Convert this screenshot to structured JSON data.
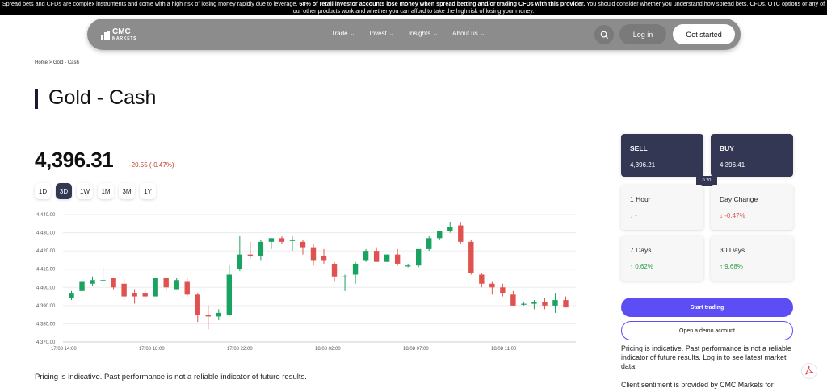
{
  "risk_warning": {
    "part1": "Spread bets and CFDs are complex instruments and come with a high risk of losing money rapidly due to leverage. ",
    "bold": "68% of retail investor accounts lose money when spread betting and/or trading CFDs with this provider.",
    "part2": " You should consider whether you understand how spread bets, CFDs, OTC options or any of our other products work and whether you can afford to take the high risk of losing your money."
  },
  "nav": {
    "logo_top": "CMC",
    "logo_bottom": "MARKETS",
    "links": [
      "Trade",
      "Invest",
      "Insights",
      "About us"
    ],
    "login": "Log in",
    "get_started": "Get started"
  },
  "breadcrumb": "Home > Gold - Cash",
  "page_title": "Gold - Cash",
  "price": "4,396.31",
  "change": "-20.55 (-0.47%)",
  "ranges": [
    "1D",
    "3D",
    "1W",
    "1M",
    "3M",
    "1Y"
  ],
  "active_range": "3D",
  "chart_data": {
    "type": "candlestick",
    "ylim": [
      4370,
      4440
    ],
    "y_ticks": [
      "4,440.00",
      "4,430.00",
      "4,420.00",
      "4,410.00",
      "4,400.00",
      "4,390.00",
      "4,380.00",
      "4,370.00"
    ],
    "x_ticks": [
      "17/08 14:00",
      "17/08 18:00",
      "17/08 22:00",
      "18/08 02:00",
      "18/08 07:00",
      "18/08 11:00"
    ],
    "candles": [
      {
        "o": 4394,
        "h": 4398,
        "l": 4393,
        "c": 4397
      },
      {
        "o": 4398,
        "h": 4403,
        "l": 4392,
        "c": 4403
      },
      {
        "o": 4402,
        "h": 4406,
        "l": 4401,
        "c": 4404
      },
      {
        "o": 4404,
        "h": 4411,
        "l": 4403,
        "c": 4404
      },
      {
        "o": 4405,
        "h": 4405,
        "l": 4399,
        "c": 4400
      },
      {
        "o": 4402,
        "h": 4405,
        "l": 4393,
        "c": 4395
      },
      {
        "o": 4397,
        "h": 4399,
        "l": 4391,
        "c": 4395
      },
      {
        "o": 4397,
        "h": 4399,
        "l": 4394,
        "c": 4395
      },
      {
        "o": 4395,
        "h": 4405,
        "l": 4395,
        "c": 4405
      },
      {
        "o": 4405,
        "h": 4405,
        "l": 4398,
        "c": 4400
      },
      {
        "o": 4399,
        "h": 4405,
        "l": 4399,
        "c": 4404
      },
      {
        "o": 4403,
        "h": 4405,
        "l": 4395,
        "c": 4396
      },
      {
        "o": 4396,
        "h": 4397,
        "l": 4381,
        "c": 4385
      },
      {
        "o": 4385,
        "h": 4390,
        "l": 4377,
        "c": 4384
      },
      {
        "o": 4384,
        "h": 4388,
        "l": 4382,
        "c": 4386
      },
      {
        "o": 4385,
        "h": 4412,
        "l": 4384,
        "c": 4407
      },
      {
        "o": 4410,
        "h": 4428,
        "l": 4409,
        "c": 4418
      },
      {
        "o": 4418,
        "h": 4425,
        "l": 4416,
        "c": 4417
      },
      {
        "o": 4417,
        "h": 4426,
        "l": 4415,
        "c": 4425
      },
      {
        "o": 4425,
        "h": 4427,
        "l": 4421,
        "c": 4427
      },
      {
        "o": 4427,
        "h": 4428,
        "l": 4424,
        "c": 4425
      },
      {
        "o": 4426,
        "h": 4428,
        "l": 4420,
        "c": 4426
      },
      {
        "o": 4425,
        "h": 4426,
        "l": 4418,
        "c": 4422
      },
      {
        "o": 4422,
        "h": 4424,
        "l": 4412,
        "c": 4415
      },
      {
        "o": 4417,
        "h": 4421,
        "l": 4413,
        "c": 4415
      },
      {
        "o": 4413,
        "h": 4414,
        "l": 4403,
        "c": 4406
      },
      {
        "o": 4406,
        "h": 4407,
        "l": 4398,
        "c": 4406
      },
      {
        "o": 4407,
        "h": 4414,
        "l": 4402,
        "c": 4413
      },
      {
        "o": 4415,
        "h": 4421,
        "l": 4414,
        "c": 4420
      },
      {
        "o": 4420,
        "h": 4422,
        "l": 4414,
        "c": 4414
      },
      {
        "o": 4414,
        "h": 4418,
        "l": 4414,
        "c": 4418
      },
      {
        "o": 4418,
        "h": 4421,
        "l": 4412,
        "c": 4413
      },
      {
        "o": 4412,
        "h": 4413,
        "l": 4411,
        "c": 4412
      },
      {
        "o": 4412,
        "h": 4421,
        "l": 4411,
        "c": 4421
      },
      {
        "o": 4421,
        "h": 4428,
        "l": 4420,
        "c": 4427
      },
      {
        "o": 4427,
        "h": 4431,
        "l": 4426,
        "c": 4431
      },
      {
        "o": 4431,
        "h": 4436,
        "l": 4430,
        "c": 4433
      },
      {
        "o": 4434,
        "h": 4436,
        "l": 4424,
        "c": 4425
      },
      {
        "o": 4425,
        "h": 4426,
        "l": 4407,
        "c": 4408
      },
      {
        "o": 4407,
        "h": 4408,
        "l": 4400,
        "c": 4402
      },
      {
        "o": 4402,
        "h": 4403,
        "l": 4396,
        "c": 4400
      },
      {
        "o": 4400,
        "h": 4402,
        "l": 4395,
        "c": 4397
      },
      {
        "o": 4396,
        "h": 4398,
        "l": 4390,
        "c": 4390
      },
      {
        "o": 4391,
        "h": 4392,
        "l": 4390,
        "c": 4391
      },
      {
        "o": 4391,
        "h": 4393,
        "l": 4388,
        "c": 4392
      },
      {
        "o": 4392,
        "h": 4394,
        "l": 4388,
        "c": 4390
      },
      {
        "o": 4390,
        "h": 4397,
        "l": 4386,
        "c": 4393
      },
      {
        "o": 4393,
        "h": 4395,
        "l": 4389,
        "c": 4389
      }
    ]
  },
  "sell": {
    "label": "SELL",
    "value": "4,396.21"
  },
  "buy": {
    "label": "BUY",
    "value": "4,396.41"
  },
  "spread": "0.20",
  "stats": [
    {
      "label": "1 Hour",
      "value": "-",
      "dir": "down"
    },
    {
      "label": "Day Change",
      "value": "-0.47%",
      "dir": "down"
    },
    {
      "label": "7 Days",
      "value": "0.62%",
      "dir": "up"
    },
    {
      "label": "30 Days",
      "value": "9.68%",
      "dir": "up"
    }
  ],
  "start_trading": "Start trading",
  "demo_account": "Open a demo account",
  "side_note": {
    "before": "Pricing is indicative. Past performance is not a reliable indicator of future results. ",
    "link": "Log in",
    "after": " to see latest market data."
  },
  "disclaimer": "Pricing is indicative. Past performance is not a reliable indicator of future results.",
  "sentiment": "Client sentiment is provided by CMC Markets for",
  "colors": {
    "up": "#1aa260",
    "down": "#e0524f",
    "dark": "#343753",
    "accent": "#5c4df5"
  }
}
